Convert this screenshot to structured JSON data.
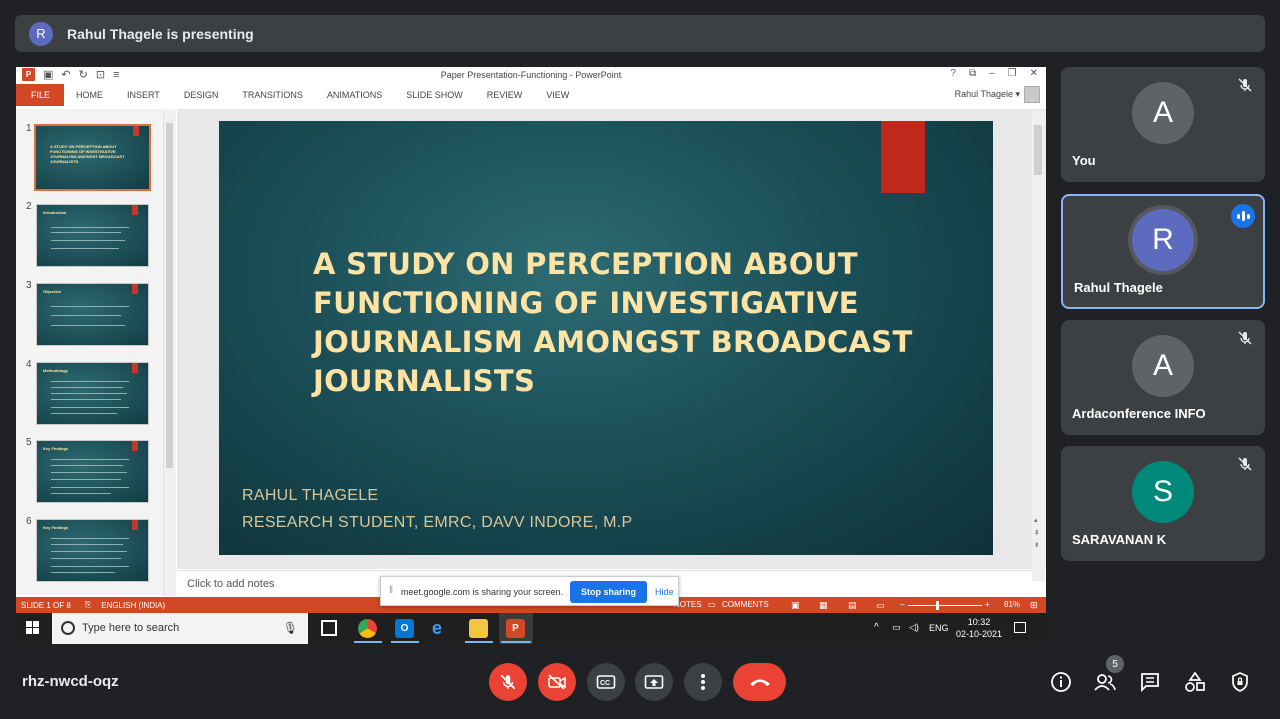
{
  "banner": {
    "avatar_letter": "R",
    "text": "Rahul Thagele is presenting"
  },
  "ppt": {
    "window_title": "Paper Presentation-Functioning - PowerPoint",
    "window_controls": [
      "?",
      "⧉",
      "–",
      "❐",
      "✕"
    ],
    "tabs": [
      "FILE",
      "HOME",
      "INSERT",
      "DESIGN",
      "TRANSITIONS",
      "ANIMATIONS",
      "SLIDE SHOW",
      "REVIEW",
      "VIEW"
    ],
    "user": "Rahul Thagele ▾",
    "thumbnails": [
      {
        "num": "1",
        "title": "A STUDY ON PERCEPTION ABOUT FUNCTIONING OF INVESTIGATIVE JOURNALISM AMONGST BROADCAST JOURNALISTS"
      },
      {
        "num": "2",
        "title": "Introduction"
      },
      {
        "num": "3",
        "title": "Objective"
      },
      {
        "num": "4",
        "title": "Methodology"
      },
      {
        "num": "5",
        "title": "Key Findings"
      },
      {
        "num": "6",
        "title": "Key Findings"
      }
    ],
    "slide": {
      "title": "A STUDY ON PERCEPTION ABOUT FUNCTIONING OF INVESTIGATIVE JOURNALISM AMONGST BROADCAST JOURNALISTS",
      "author": "RAHUL THAGELE",
      "affiliation": "RESEARCH STUDENT, EMRC, DAVV INDORE, M.P"
    },
    "notes_placeholder": "Click to add notes",
    "status": {
      "slide": "SLIDE 1 OF 8",
      "language": "ENGLISH (INDIA)",
      "notes": "NOTES",
      "comments": "COMMENTS",
      "zoom": "81%"
    }
  },
  "taskbar": {
    "search_placeholder": "Type here to search",
    "lang": "ENG",
    "time": "10:32",
    "date": "02-10-2021"
  },
  "share_popup": {
    "message": "meet.google.com is sharing your screen.",
    "stop": "Stop sharing",
    "hide": "Hide"
  },
  "participants": [
    {
      "letter": "A",
      "name": "You",
      "color": "#5f6368",
      "muted": true
    },
    {
      "letter": "R",
      "name": "Rahul Thagele",
      "color": "#5c6bc0",
      "muted": false,
      "speaking": true
    },
    {
      "letter": "A",
      "name": "Ardaconference INFO",
      "color": "#5f6368",
      "muted": true
    },
    {
      "letter": "S",
      "name": "SARAVANAN K",
      "color": "#00897b",
      "muted": true
    }
  ],
  "meeting": {
    "code": "rhz-nwcd-oqz",
    "people_count": "5"
  },
  "colors": {
    "end_call": "#ea4335",
    "ppt_accent": "#d24726",
    "meet_blue": "#1a73e8"
  }
}
